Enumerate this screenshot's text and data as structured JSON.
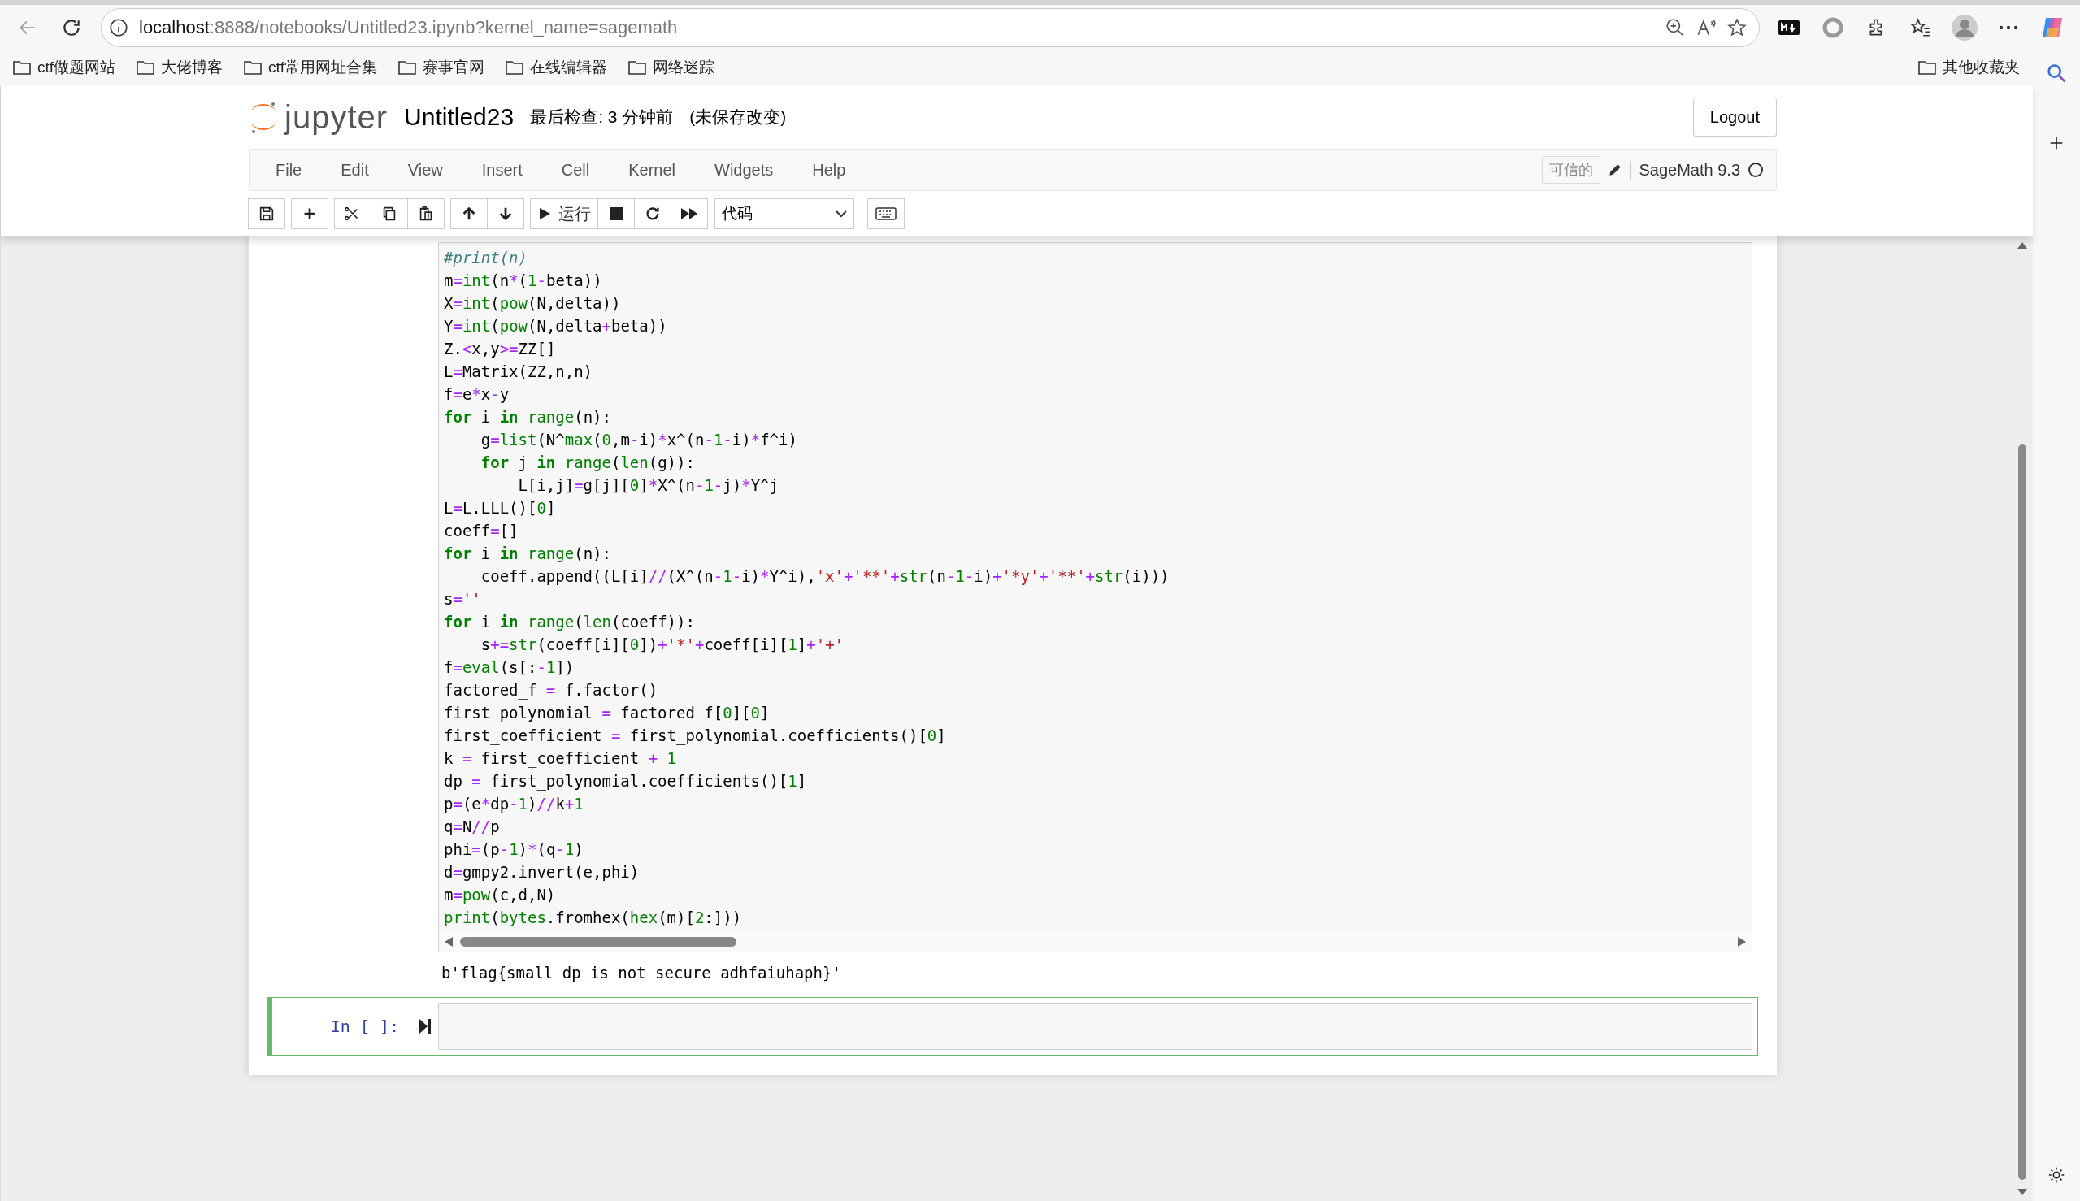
{
  "browser": {
    "url_host": "localhost",
    "url_rest": ":8888/notebooks/Untitled23.ipynb?kernel_name=sagemath",
    "bookmarks": [
      "ctf做题网站",
      "大佬博客",
      "ctf常用网址合集",
      "赛事官网",
      "在线编辑器",
      "网络迷踪"
    ],
    "other_bookmarks": "其他收藏夹"
  },
  "header": {
    "logo": "jupyter",
    "title": "Untitled23",
    "checkpoint": "最后检查: 3 分钟前",
    "unsaved": "(未保存改变)",
    "logout": "Logout"
  },
  "menu": [
    "File",
    "Edit",
    "View",
    "Insert",
    "Cell",
    "Kernel",
    "Widgets",
    "Help"
  ],
  "kernel": {
    "trusted": "可信的",
    "name": "SageMath 9.3",
    "busy": false
  },
  "toolbar": {
    "run_label": "运行",
    "cell_type": "代码"
  },
  "cells": [
    {
      "selected": false,
      "lines": [
        [
          {
            "kind": "comment",
            "text": "#print(n)"
          }
        ],
        [
          {
            "kind": "plain",
            "text": "m"
          },
          {
            "kind": "op",
            "text": "="
          },
          {
            "kind": "builtin",
            "text": "int"
          },
          {
            "kind": "plain",
            "text": "(n"
          },
          {
            "kind": "op",
            "text": "*"
          },
          {
            "kind": "plain",
            "text": "("
          },
          {
            "kind": "num",
            "text": "1"
          },
          {
            "kind": "op",
            "text": "-"
          },
          {
            "kind": "plain",
            "text": "beta))"
          }
        ],
        [
          {
            "kind": "plain",
            "text": "X"
          },
          {
            "kind": "op",
            "text": "="
          },
          {
            "kind": "builtin",
            "text": "int"
          },
          {
            "kind": "plain",
            "text": "("
          },
          {
            "kind": "builtin",
            "text": "pow"
          },
          {
            "kind": "plain",
            "text": "(N,delta))"
          }
        ],
        [
          {
            "kind": "plain",
            "text": "Y"
          },
          {
            "kind": "op",
            "text": "="
          },
          {
            "kind": "builtin",
            "text": "int"
          },
          {
            "kind": "plain",
            "text": "("
          },
          {
            "kind": "builtin",
            "text": "pow"
          },
          {
            "kind": "plain",
            "text": "(N,delta"
          },
          {
            "kind": "op",
            "text": "+"
          },
          {
            "kind": "plain",
            "text": "beta))"
          }
        ],
        [
          {
            "kind": "plain",
            "text": "Z."
          },
          {
            "kind": "op",
            "text": "<"
          },
          {
            "kind": "plain",
            "text": "x,y"
          },
          {
            "kind": "op",
            "text": ">="
          },
          {
            "kind": "plain",
            "text": "ZZ[]"
          }
        ],
        [
          {
            "kind": "plain",
            "text": "L"
          },
          {
            "kind": "op",
            "text": "="
          },
          {
            "kind": "plain",
            "text": "Matrix(ZZ,n,n)"
          }
        ],
        [
          {
            "kind": "plain",
            "text": "f"
          },
          {
            "kind": "op",
            "text": "="
          },
          {
            "kind": "plain",
            "text": "e"
          },
          {
            "kind": "op",
            "text": "*"
          },
          {
            "kind": "plain",
            "text": "x"
          },
          {
            "kind": "op",
            "text": "-"
          },
          {
            "kind": "plain",
            "text": "y"
          }
        ],
        [
          {
            "kind": "keyword",
            "text": "for"
          },
          {
            "kind": "plain",
            "text": " i "
          },
          {
            "kind": "keyword",
            "text": "in"
          },
          {
            "kind": "builtin",
            "text": " range"
          },
          {
            "kind": "plain",
            "text": "(n):"
          }
        ],
        [
          {
            "kind": "plain",
            "text": "    g"
          },
          {
            "kind": "op",
            "text": "="
          },
          {
            "kind": "builtin",
            "text": "list"
          },
          {
            "kind": "plain",
            "text": "(N^"
          },
          {
            "kind": "builtin",
            "text": "max"
          },
          {
            "kind": "plain",
            "text": "("
          },
          {
            "kind": "num",
            "text": "0"
          },
          {
            "kind": "plain",
            "text": ",m"
          },
          {
            "kind": "op",
            "text": "-"
          },
          {
            "kind": "plain",
            "text": "i)"
          },
          {
            "kind": "op",
            "text": "*"
          },
          {
            "kind": "plain",
            "text": "x^(n"
          },
          {
            "kind": "op",
            "text": "-"
          },
          {
            "kind": "num",
            "text": "1"
          },
          {
            "kind": "op",
            "text": "-"
          },
          {
            "kind": "plain",
            "text": "i)"
          },
          {
            "kind": "op",
            "text": "*"
          },
          {
            "kind": "plain",
            "text": "f^i)"
          }
        ],
        [
          {
            "kind": "keyword",
            "text": "    for"
          },
          {
            "kind": "plain",
            "text": " j "
          },
          {
            "kind": "keyword",
            "text": "in"
          },
          {
            "kind": "builtin",
            "text": " range"
          },
          {
            "kind": "plain",
            "text": "("
          },
          {
            "kind": "builtin",
            "text": "len"
          },
          {
            "kind": "plain",
            "text": "(g)):"
          }
        ],
        [
          {
            "kind": "plain",
            "text": "        L[i,j]"
          },
          {
            "kind": "op",
            "text": "="
          },
          {
            "kind": "plain",
            "text": "g[j]["
          },
          {
            "kind": "num",
            "text": "0"
          },
          {
            "kind": "plain",
            "text": "]"
          },
          {
            "kind": "op",
            "text": "*"
          },
          {
            "kind": "plain",
            "text": "X^(n"
          },
          {
            "kind": "op",
            "text": "-"
          },
          {
            "kind": "num",
            "text": "1"
          },
          {
            "kind": "op",
            "text": "-"
          },
          {
            "kind": "plain",
            "text": "j)"
          },
          {
            "kind": "op",
            "text": "*"
          },
          {
            "kind": "plain",
            "text": "Y^j"
          }
        ],
        [
          {
            "kind": "plain",
            "text": "L"
          },
          {
            "kind": "op",
            "text": "="
          },
          {
            "kind": "plain",
            "text": "L.LLL()["
          },
          {
            "kind": "num",
            "text": "0"
          },
          {
            "kind": "plain",
            "text": "]"
          }
        ],
        [
          {
            "kind": "plain",
            "text": "coeff"
          },
          {
            "kind": "op",
            "text": "="
          },
          {
            "kind": "plain",
            "text": "[]"
          }
        ],
        [
          {
            "kind": "keyword",
            "text": "for"
          },
          {
            "kind": "plain",
            "text": " i "
          },
          {
            "kind": "keyword",
            "text": "in"
          },
          {
            "kind": "builtin",
            "text": " range"
          },
          {
            "kind": "plain",
            "text": "(n):"
          }
        ],
        [
          {
            "kind": "plain",
            "text": "    coeff.append((L[i]"
          },
          {
            "kind": "op",
            "text": "//"
          },
          {
            "kind": "plain",
            "text": "(X^(n"
          },
          {
            "kind": "op",
            "text": "-"
          },
          {
            "kind": "num",
            "text": "1"
          },
          {
            "kind": "op",
            "text": "-"
          },
          {
            "kind": "plain",
            "text": "i)"
          },
          {
            "kind": "op",
            "text": "*"
          },
          {
            "kind": "plain",
            "text": "Y^i),"
          },
          {
            "kind": "str",
            "text": "'x'"
          },
          {
            "kind": "op",
            "text": "+"
          },
          {
            "kind": "str",
            "text": "'**'"
          },
          {
            "kind": "op",
            "text": "+"
          },
          {
            "kind": "builtin",
            "text": "str"
          },
          {
            "kind": "plain",
            "text": "(n"
          },
          {
            "kind": "op",
            "text": "-"
          },
          {
            "kind": "num",
            "text": "1"
          },
          {
            "kind": "op",
            "text": "-"
          },
          {
            "kind": "plain",
            "text": "i)"
          },
          {
            "kind": "op",
            "text": "+"
          },
          {
            "kind": "str",
            "text": "'*y'"
          },
          {
            "kind": "op",
            "text": "+"
          },
          {
            "kind": "str",
            "text": "'**'"
          },
          {
            "kind": "op",
            "text": "+"
          },
          {
            "kind": "builtin",
            "text": "str"
          },
          {
            "kind": "plain",
            "text": "(i)))"
          }
        ],
        [
          {
            "kind": "plain",
            "text": "s"
          },
          {
            "kind": "op",
            "text": "="
          },
          {
            "kind": "str",
            "text": "''"
          }
        ],
        [
          {
            "kind": "keyword",
            "text": "for"
          },
          {
            "kind": "plain",
            "text": " i "
          },
          {
            "kind": "keyword",
            "text": "in"
          },
          {
            "kind": "builtin",
            "text": " range"
          },
          {
            "kind": "plain",
            "text": "("
          },
          {
            "kind": "builtin",
            "text": "len"
          },
          {
            "kind": "plain",
            "text": "(coeff)):"
          }
        ],
        [
          {
            "kind": "plain",
            "text": "    s"
          },
          {
            "kind": "op",
            "text": "+="
          },
          {
            "kind": "builtin",
            "text": "str"
          },
          {
            "kind": "plain",
            "text": "(coeff[i]["
          },
          {
            "kind": "num",
            "text": "0"
          },
          {
            "kind": "plain",
            "text": "])"
          },
          {
            "kind": "op",
            "text": "+"
          },
          {
            "kind": "str",
            "text": "'*'"
          },
          {
            "kind": "op",
            "text": "+"
          },
          {
            "kind": "plain",
            "text": "coeff[i]["
          },
          {
            "kind": "num",
            "text": "1"
          },
          {
            "kind": "plain",
            "text": "]"
          },
          {
            "kind": "op",
            "text": "+"
          },
          {
            "kind": "str",
            "text": "'+'"
          }
        ],
        [
          {
            "kind": "plain",
            "text": "f"
          },
          {
            "kind": "op",
            "text": "="
          },
          {
            "kind": "builtin",
            "text": "eval"
          },
          {
            "kind": "plain",
            "text": "(s[:"
          },
          {
            "kind": "op",
            "text": "-"
          },
          {
            "kind": "num",
            "text": "1"
          },
          {
            "kind": "plain",
            "text": "])"
          }
        ],
        [
          {
            "kind": "plain",
            "text": "factored_f "
          },
          {
            "kind": "op",
            "text": "="
          },
          {
            "kind": "plain",
            "text": " f.factor()"
          }
        ],
        [
          {
            "kind": "plain",
            "text": "first_polynomial "
          },
          {
            "kind": "op",
            "text": "="
          },
          {
            "kind": "plain",
            "text": " factored_f["
          },
          {
            "kind": "num",
            "text": "0"
          },
          {
            "kind": "plain",
            "text": "]["
          },
          {
            "kind": "num",
            "text": "0"
          },
          {
            "kind": "plain",
            "text": "]"
          }
        ],
        [
          {
            "kind": "plain",
            "text": "first_coefficient "
          },
          {
            "kind": "op",
            "text": "="
          },
          {
            "kind": "plain",
            "text": " first_polynomial.coefficients()["
          },
          {
            "kind": "num",
            "text": "0"
          },
          {
            "kind": "plain",
            "text": "]"
          }
        ],
        [
          {
            "kind": "plain",
            "text": "k "
          },
          {
            "kind": "op",
            "text": "="
          },
          {
            "kind": "plain",
            "text": " first_coefficient "
          },
          {
            "kind": "op",
            "text": "+"
          },
          {
            "kind": "num",
            "text": " 1"
          }
        ],
        [
          {
            "kind": "plain",
            "text": "dp "
          },
          {
            "kind": "op",
            "text": "="
          },
          {
            "kind": "plain",
            "text": " first_polynomial.coefficients()["
          },
          {
            "kind": "num",
            "text": "1"
          },
          {
            "kind": "plain",
            "text": "]"
          }
        ],
        [
          {
            "kind": "plain",
            "text": "p"
          },
          {
            "kind": "op",
            "text": "="
          },
          {
            "kind": "plain",
            "text": "(e"
          },
          {
            "kind": "op",
            "text": "*"
          },
          {
            "kind": "plain",
            "text": "dp"
          },
          {
            "kind": "op",
            "text": "-"
          },
          {
            "kind": "num",
            "text": "1"
          },
          {
            "kind": "plain",
            "text": ")"
          },
          {
            "kind": "op",
            "text": "//"
          },
          {
            "kind": "plain",
            "text": "k"
          },
          {
            "kind": "op",
            "text": "+"
          },
          {
            "kind": "num",
            "text": "1"
          }
        ],
        [
          {
            "kind": "plain",
            "text": "q"
          },
          {
            "kind": "op",
            "text": "="
          },
          {
            "kind": "plain",
            "text": "N"
          },
          {
            "kind": "op",
            "text": "//"
          },
          {
            "kind": "plain",
            "text": "p"
          }
        ],
        [
          {
            "kind": "plain",
            "text": "phi"
          },
          {
            "kind": "op",
            "text": "="
          },
          {
            "kind": "plain",
            "text": "(p"
          },
          {
            "kind": "op",
            "text": "-"
          },
          {
            "kind": "num",
            "text": "1"
          },
          {
            "kind": "plain",
            "text": ")"
          },
          {
            "kind": "op",
            "text": "*"
          },
          {
            "kind": "plain",
            "text": "(q"
          },
          {
            "kind": "op",
            "text": "-"
          },
          {
            "kind": "num",
            "text": "1"
          },
          {
            "kind": "plain",
            "text": ")"
          }
        ],
        [
          {
            "kind": "plain",
            "text": "d"
          },
          {
            "kind": "op",
            "text": "="
          },
          {
            "kind": "plain",
            "text": "gmpy2.invert(e,phi)"
          }
        ],
        [
          {
            "kind": "plain",
            "text": "m"
          },
          {
            "kind": "op",
            "text": "="
          },
          {
            "kind": "builtin",
            "text": "pow"
          },
          {
            "kind": "plain",
            "text": "(c,d,N)"
          }
        ],
        [
          {
            "kind": "builtin",
            "text": "print"
          },
          {
            "kind": "plain",
            "text": "("
          },
          {
            "kind": "builtin",
            "text": "bytes"
          },
          {
            "kind": "plain",
            "text": ".fromhex("
          },
          {
            "kind": "builtin",
            "text": "hex"
          },
          {
            "kind": "plain",
            "text": "(m)["
          },
          {
            "kind": "num",
            "text": "2"
          },
          {
            "kind": "plain",
            "text": ":]))"
          }
        ]
      ],
      "output": "b'flag{small_dp_is_not_secure_adhfaiuhaph}'"
    },
    {
      "selected": true,
      "prompt": "In [ ]:"
    }
  ]
}
